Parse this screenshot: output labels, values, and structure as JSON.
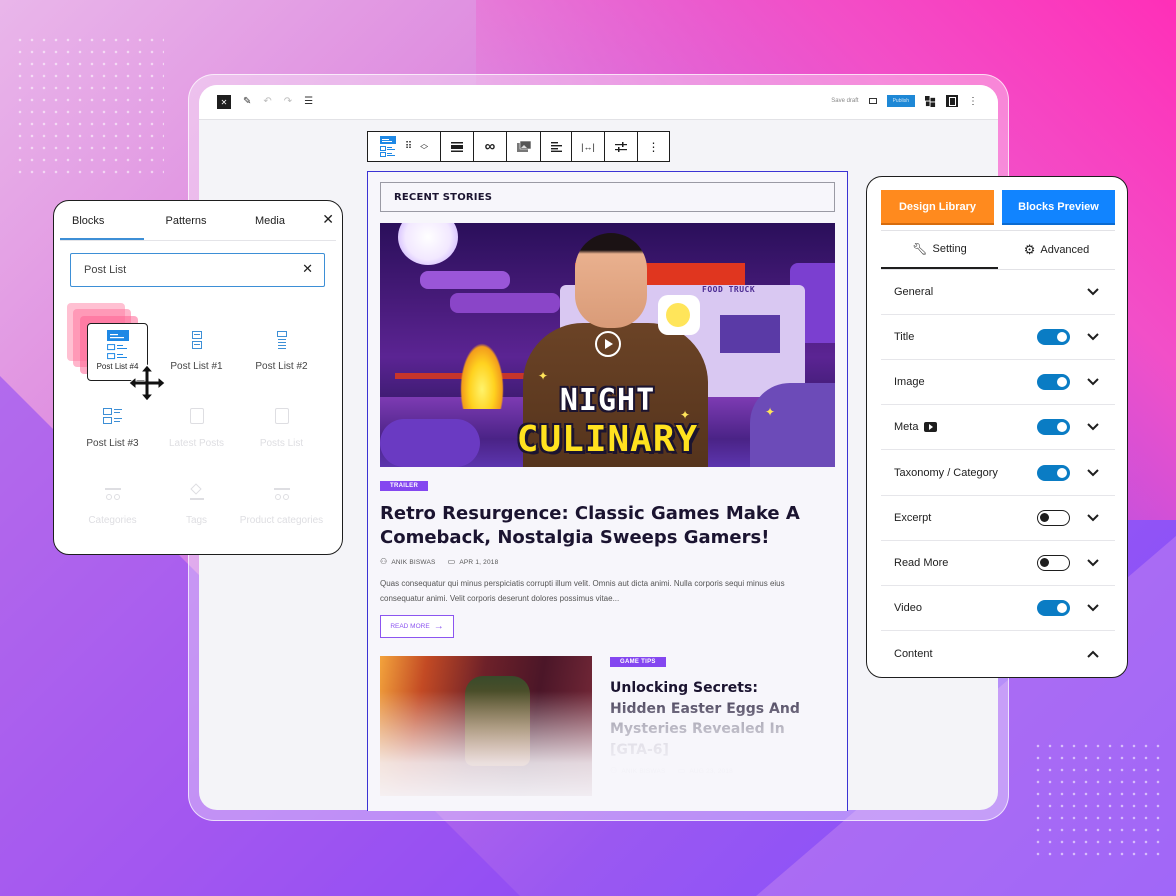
{
  "editor": {
    "topbar": {
      "save_draft": "Save draft",
      "publish": "Publish",
      "icons": [
        "wordpress-logo-icon",
        "edit-pen-icon",
        "undo-icon",
        "redo-icon",
        "list-view-icon",
        "preview-icon",
        "block-editor-logo-icon",
        "settings-sidebar-icon",
        "more-options-icon"
      ]
    },
    "block_toolbar": {
      "items": [
        "post-list-block-icon",
        "drag-handle-icon",
        "move-up-down-icon",
        "align-full-icon",
        "link-icon",
        "image-icon",
        "text-align-icon",
        "width-icon",
        "settings-sliders-icon",
        "more-options-icon"
      ]
    },
    "post_block": {
      "section_heading": "RECENT STORIES",
      "featured": {
        "image_title_line1": "NIGHT",
        "image_title_line2": "CULINARY",
        "image_sign": "FOOD TRUCK",
        "category": "TRAILER",
        "title": "Retro Resurgence: Classic Games Make A Comeback, Nostalgia Sweeps Gamers!",
        "author": "ANIK BISWAS",
        "date": "APR 1, 2018",
        "excerpt": "Quas consequatur qui minus perspiciatis corrupti illum velit. Omnis aut dicta animi. Nulla corporis sequi minus eius consequatur animi. Velit corporis deserunt dolores possimus vitae...",
        "read_more": "READ MORE"
      },
      "second": {
        "category": "GAME TIPS",
        "title_lines": [
          "Unlocking Secrets:",
          "Hidden Easter Eggs And",
          "Mysteries Revealed In",
          "[GTA-6]"
        ],
        "author": "ANIK BISWAS",
        "date": "AUG 23, 2018"
      }
    }
  },
  "inserter": {
    "tabs": [
      {
        "label": "Blocks",
        "active": true
      },
      {
        "label": "Patterns",
        "active": false
      },
      {
        "label": "Media",
        "active": false
      }
    ],
    "search": {
      "value": "Post List"
    },
    "items": [
      {
        "label": "Post List #4",
        "dragging": true
      },
      {
        "label": "Post List #1",
        "enabled": true
      },
      {
        "label": "Post List #2",
        "enabled": true
      },
      {
        "label": "Post List #3",
        "enabled": true
      },
      {
        "label": "Latest Posts",
        "enabled": false
      },
      {
        "label": "Posts List",
        "enabled": false
      },
      {
        "label": "Categories",
        "enabled": false
      },
      {
        "label": "Tags",
        "enabled": false
      },
      {
        "label": "Product categories",
        "enabled": false
      }
    ]
  },
  "settings": {
    "design_library": "Design Library",
    "blocks_preview": "Blocks Preview",
    "colors": {
      "design_library": "#ff8a1e",
      "blocks_preview": "#1184ff",
      "toggle_on": "#0a7cc4"
    },
    "tabs": [
      {
        "label": "Setting",
        "icon": "wrench-icon",
        "active": true
      },
      {
        "label": "Advanced",
        "icon": "gear-icon",
        "active": false
      }
    ],
    "rows": [
      {
        "label": "General",
        "toggle": null,
        "expanded": false
      },
      {
        "label": "Title",
        "toggle": true,
        "expanded": false
      },
      {
        "label": "Image",
        "toggle": true,
        "expanded": false
      },
      {
        "label": "Meta",
        "toggle": true,
        "expanded": false,
        "has_video_icon": true
      },
      {
        "label": "Taxonomy / Category",
        "toggle": true,
        "expanded": false
      },
      {
        "label": "Excerpt",
        "toggle": false,
        "expanded": false
      },
      {
        "label": "Read More",
        "toggle": false,
        "expanded": false
      },
      {
        "label": "Video",
        "toggle": true,
        "expanded": false
      },
      {
        "label": "Content",
        "toggle": null,
        "expanded": true
      }
    ]
  }
}
